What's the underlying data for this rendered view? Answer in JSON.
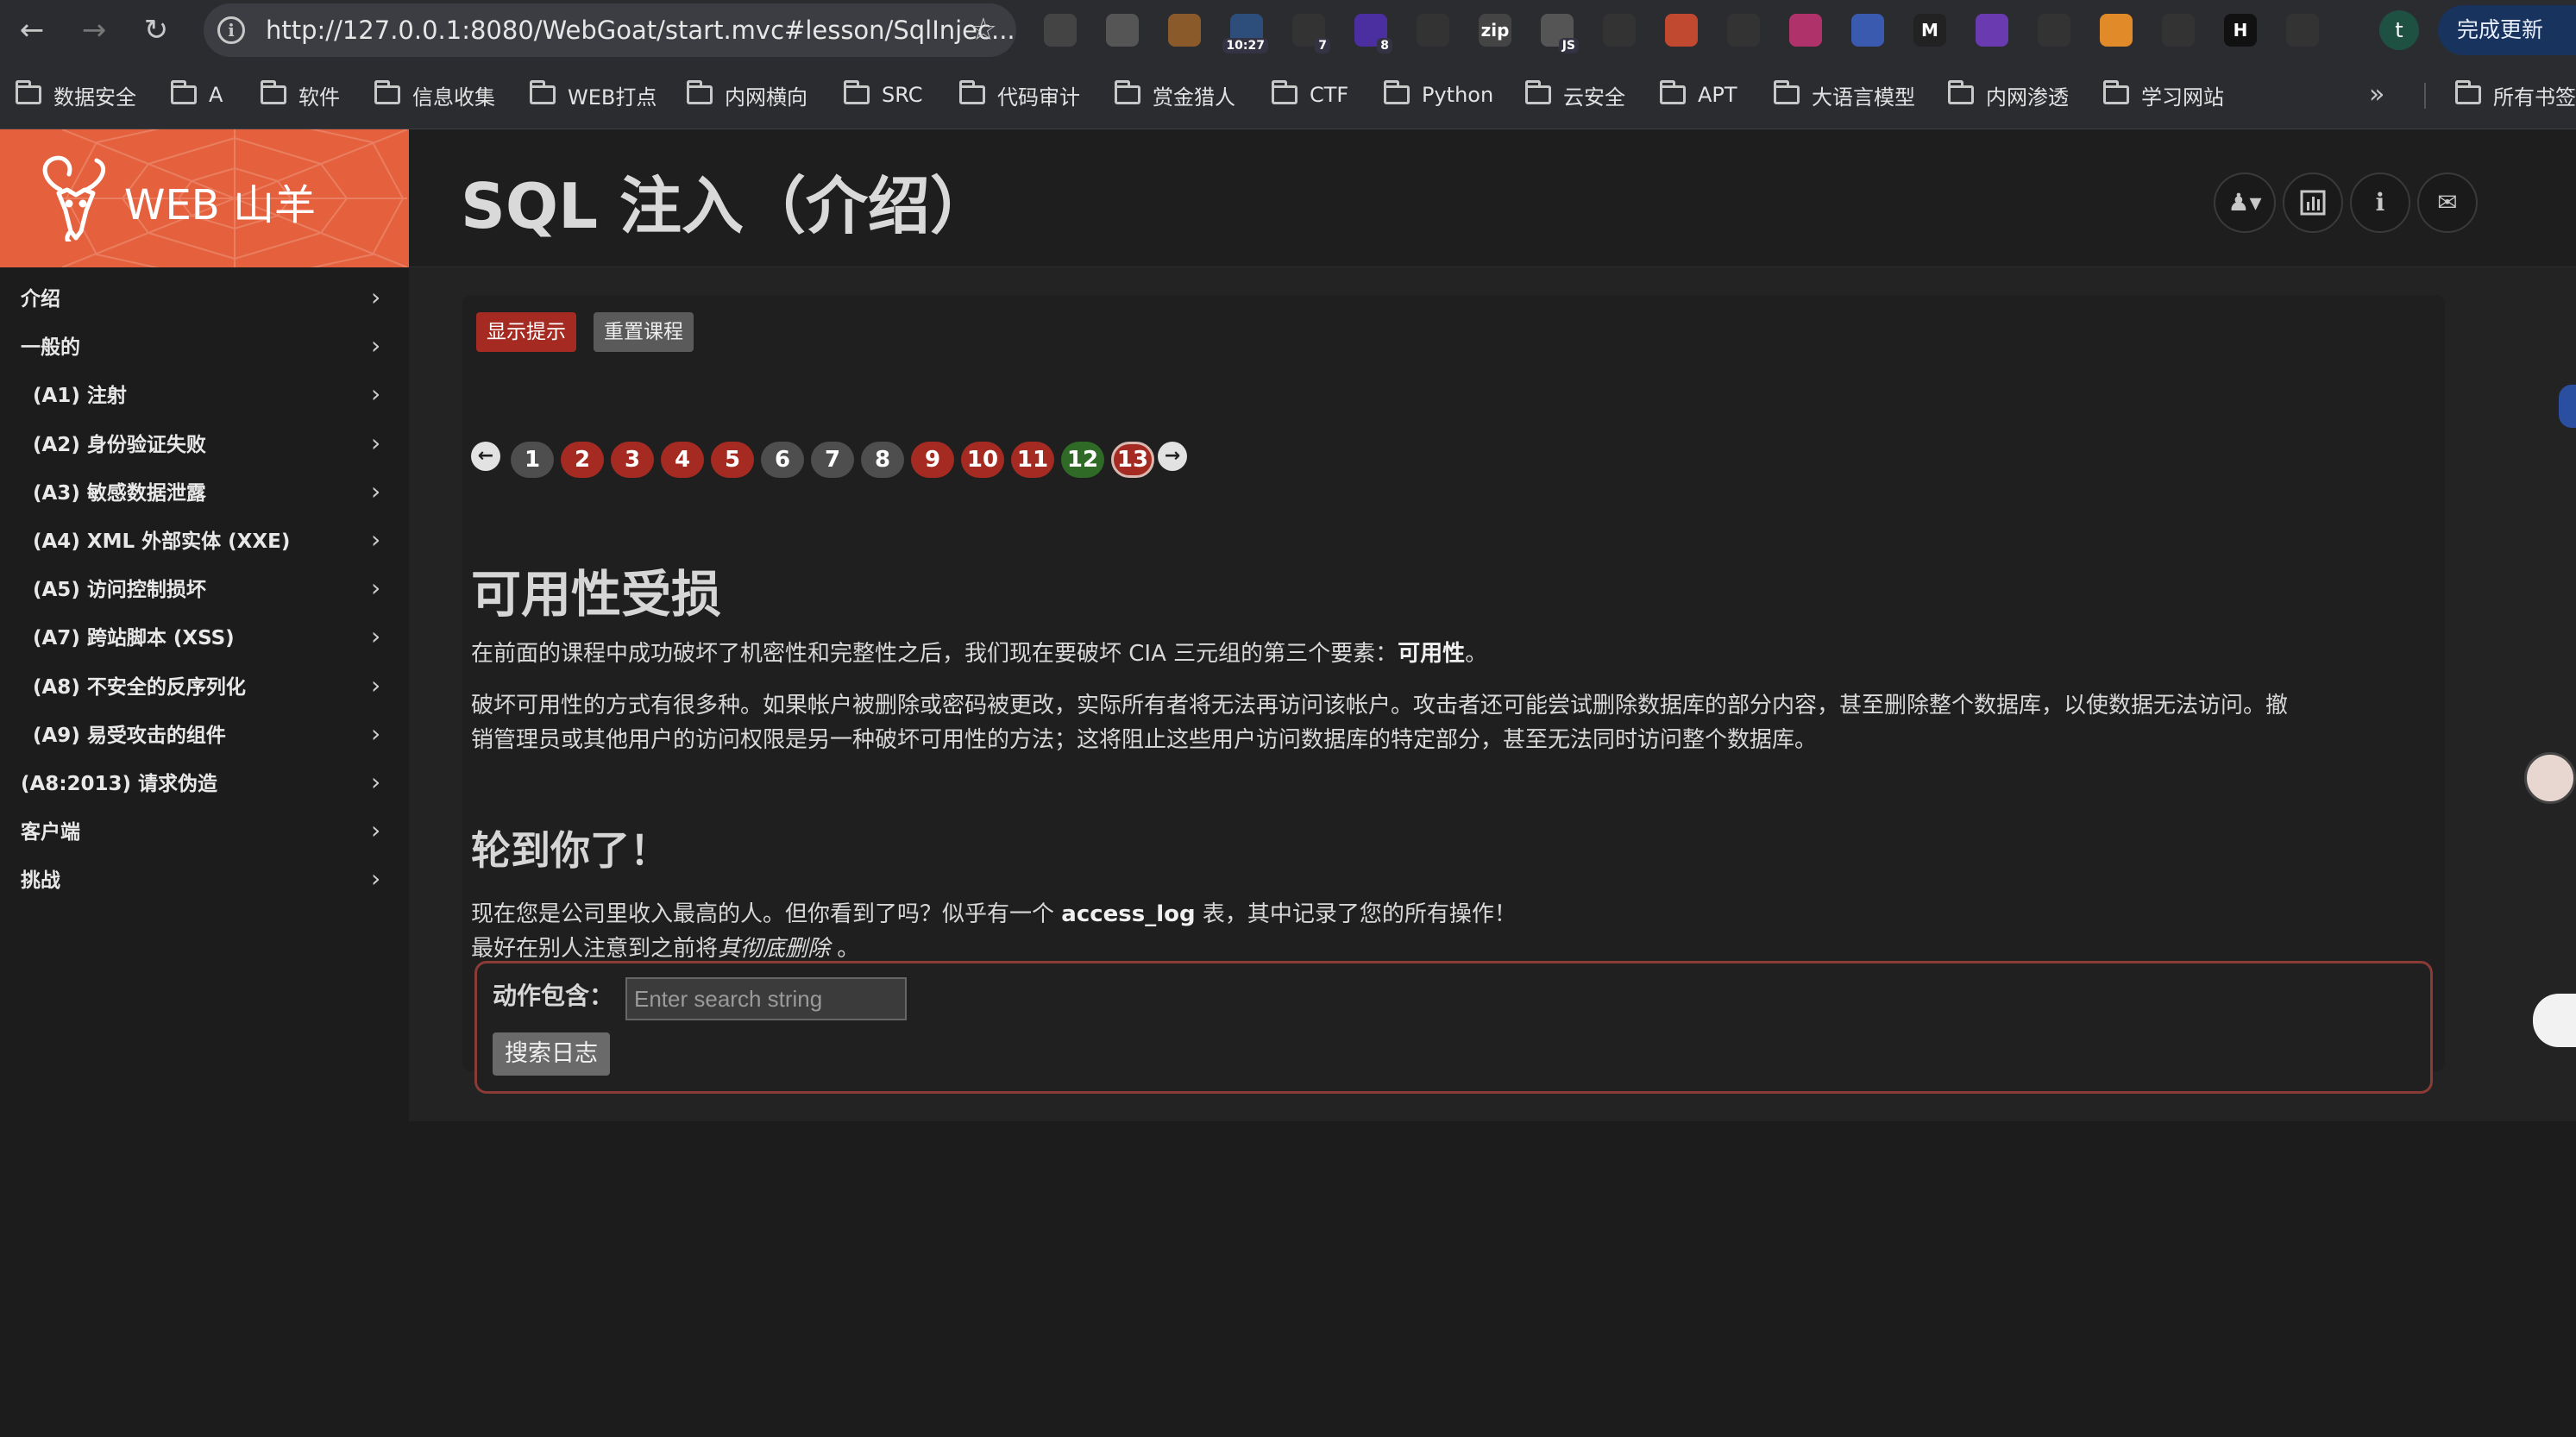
{
  "browser": {
    "url": "http://127.0.0.1:8080/WebGoat/start.mvc#lesson/SqlInjec...",
    "update_button": "完成更新",
    "profile_initial": "t",
    "extensions": [
      {
        "name": "goat-extension-icon",
        "label": "",
        "badge": ""
      },
      {
        "name": "settings-extension-icon",
        "label": "",
        "badge": ""
      },
      {
        "name": "cookie-extension-icon",
        "label": "",
        "badge": ""
      },
      {
        "name": "clock-extension-icon",
        "label": "",
        "badge": "10:27"
      },
      {
        "name": "calendar-extension-icon",
        "label": "",
        "badge": "7"
      },
      {
        "name": "shapes-extension-icon",
        "label": "",
        "badge": "8"
      },
      {
        "name": "mask-extension-icon",
        "label": "",
        "badge": ""
      },
      {
        "name": "zip-extension-icon",
        "label": "zip",
        "badge": ""
      },
      {
        "name": "js-extension-icon",
        "label": "",
        "badge": "JS"
      },
      {
        "name": "arrow-extension-icon",
        "label": "",
        "badge": ""
      },
      {
        "name": "record-extension-icon",
        "label": "",
        "badge": ""
      },
      {
        "name": "glasses-extension-icon",
        "label": "",
        "badge": ""
      },
      {
        "name": "proxy-extension-icon",
        "label": "",
        "badge": ""
      },
      {
        "name": "orb-extension-icon",
        "label": "",
        "badge": ""
      },
      {
        "name": "m-extension-icon",
        "label": "M",
        "badge": ""
      },
      {
        "name": "shield-extension-icon",
        "label": "",
        "badge": ""
      },
      {
        "name": "wand-extension-icon",
        "label": "",
        "badge": ""
      },
      {
        "name": "box-extension-icon",
        "label": "",
        "badge": ""
      },
      {
        "name": "cards-extension-icon",
        "label": "",
        "badge": ""
      },
      {
        "name": "h-extension-icon",
        "label": "H",
        "badge": ""
      },
      {
        "name": "puzzle-extension-icon",
        "label": "",
        "badge": ""
      }
    ]
  },
  "bookmarks": [
    "数据安全",
    "A",
    "软件",
    "信息收集",
    "WEB打点",
    "内网横向",
    "SRC",
    "代码审计",
    "赏金猎人",
    "CTF",
    "Python",
    "云安全",
    "APT",
    "大语言模型",
    "内网渗透",
    "学习网站"
  ],
  "bookmarks_other": "所有书签",
  "logo": {
    "text": "WEB 山羊"
  },
  "sidebar": {
    "items": [
      {
        "label": "介绍",
        "indent": 0
      },
      {
        "label": "一般的",
        "indent": 0
      },
      {
        "label": "(A1) 注射",
        "indent": 1
      },
      {
        "label": "(A2) 身份验证失败",
        "indent": 1
      },
      {
        "label": "(A3) 敏感数据泄露",
        "indent": 1
      },
      {
        "label": "(A4) XML 外部实体 (XXE)",
        "indent": 1
      },
      {
        "label": "(A5) 访问控制损坏",
        "indent": 1
      },
      {
        "label": "(A7) 跨站脚本 (XSS)",
        "indent": 1
      },
      {
        "label": "(A8) 不安全的反序列化",
        "indent": 1
      },
      {
        "label": "(A9) 易受攻击的组件",
        "indent": 1
      },
      {
        "label": "(A8:2013) 请求伪造",
        "indent": 0
      },
      {
        "label": "客户端",
        "indent": 0
      },
      {
        "label": "挑战",
        "indent": 0
      }
    ]
  },
  "header": {
    "title": "SQL 注入（介绍）"
  },
  "lesson": {
    "show_hints": "显示提示",
    "reset_lesson": "重置课程",
    "pages": [
      {
        "n": "1",
        "state": "gray"
      },
      {
        "n": "2",
        "state": "red"
      },
      {
        "n": "3",
        "state": "red"
      },
      {
        "n": "4",
        "state": "red"
      },
      {
        "n": "5",
        "state": "red"
      },
      {
        "n": "6",
        "state": "gray"
      },
      {
        "n": "7",
        "state": "gray"
      },
      {
        "n": "8",
        "state": "gray"
      },
      {
        "n": "9",
        "state": "red"
      },
      {
        "n": "10",
        "state": "red"
      },
      {
        "n": "11",
        "state": "red"
      },
      {
        "n": "12",
        "state": "green"
      },
      {
        "n": "13",
        "state": "red",
        "current": true
      }
    ],
    "heading": "可用性受损",
    "intro_before": "在前面的课程中成功破坏了机密性和完整性之后，我们现在要破坏 CIA 三元组的第三个要素：",
    "intro_bold": "可用性",
    "intro_after": "。",
    "para_line1": "破坏可用性的方式有很多种。如果帐户被删除或密码被更改，实际所有者将无法再访问该帐户。攻击者还可能尝试删除数据库的部分内容，甚至删除整个数据库，以使数据无法访问。撤",
    "para_line2": "销管理员或其他用户的访问权限是另一种破坏可用性的方法；这将阻止这些用户访问数据库的特定部分，甚至无法同时访问整个数据库。",
    "your_turn": "轮到你了！",
    "task_before": "现在您是公司里收入最高的人。但你看到了吗？似乎有一个",
    "task_bold": "access_log",
    "task_after": "表，其中记录了您的所有操作！",
    "task2_before": "最好在别人注意到之前将",
    "task2_italic": "其彻底删除",
    "task2_after": "。",
    "form_label": "动作包含：",
    "search_placeholder": "Enter search string",
    "search_value": "",
    "search_button": "搜索日志"
  },
  "colors": {
    "brand": "#e5613d",
    "danger": "#a52b22",
    "success": "#2f6a26",
    "neutral": "#4e4e4e"
  }
}
